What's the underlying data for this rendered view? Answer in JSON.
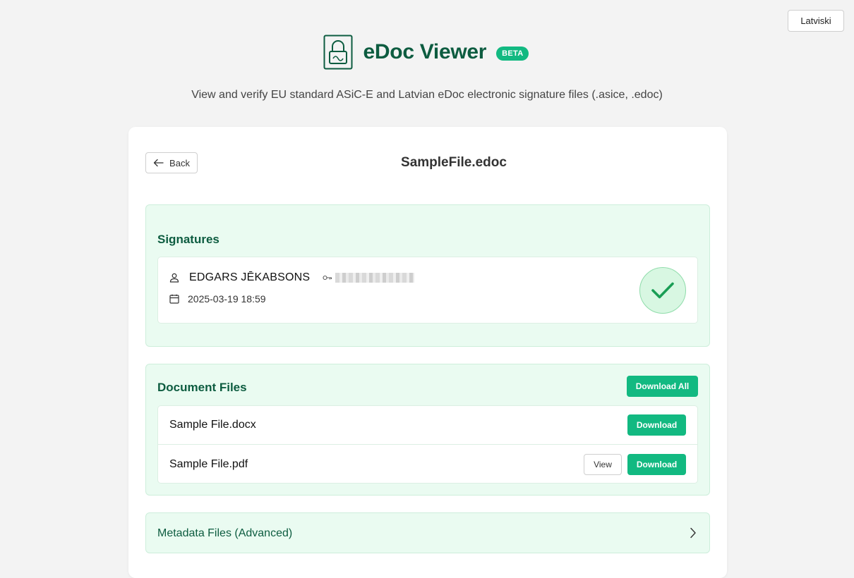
{
  "header": {
    "language_button": "Latviski",
    "app_title": "eDoc Viewer",
    "badge": "BETA",
    "subtitle": "View and verify EU standard ASiC-E and Latvian eDoc electronic signature files (.asice, .edoc)"
  },
  "document": {
    "back_label": "Back",
    "file_name": "SampleFile.edoc"
  },
  "signatures": {
    "title": "Signatures",
    "items": [
      {
        "signer": "EDGARS JĒKABSONS",
        "date": "2025-03-19 18:59",
        "status": "valid"
      }
    ]
  },
  "document_files": {
    "title": "Document Files",
    "download_all_label": "Download All",
    "files": [
      {
        "name": "Sample File.docx",
        "download_label": "Download"
      },
      {
        "name": "Sample File.pdf",
        "view_label": "View",
        "download_label": "Download"
      }
    ]
  },
  "metadata": {
    "title": "Metadata Files (Advanced)"
  },
  "colors": {
    "brand": "#0d5c40",
    "accent": "#12b981",
    "section_bg": "#eafbf1"
  }
}
